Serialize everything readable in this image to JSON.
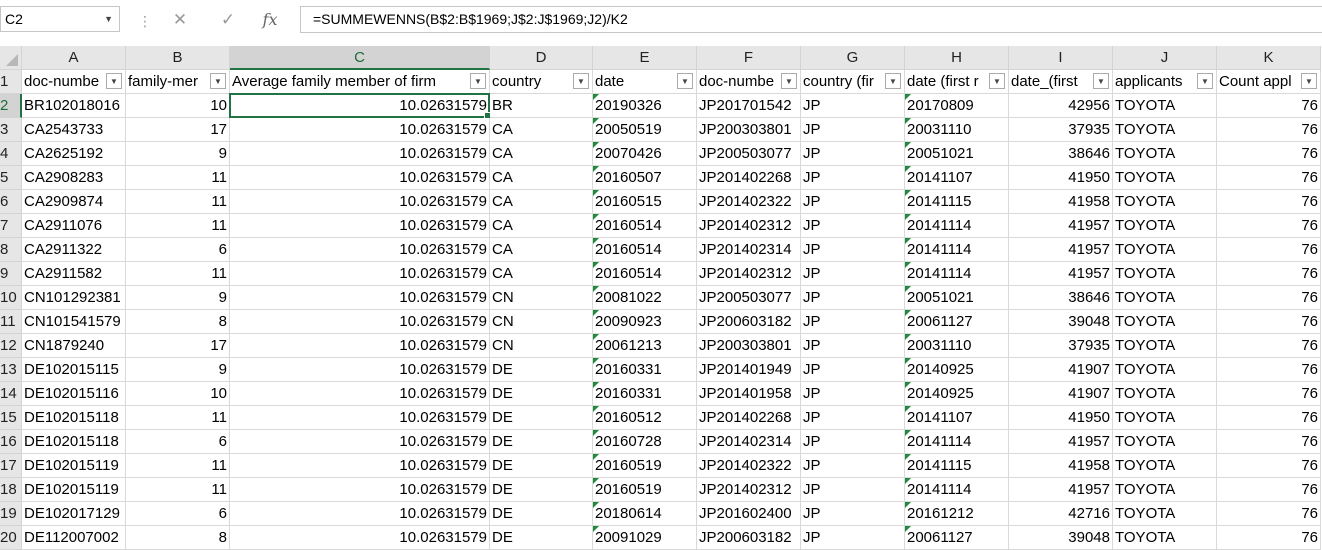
{
  "formula_bar": {
    "name_box": "C2",
    "fx_label": "fx",
    "cancel_glyph": "✕",
    "enter_glyph": "✓",
    "formula": "=SUMMEWENNS(B$2:B$1969;J$2:J$1969;J2)/K2"
  },
  "columns": [
    {
      "id": "A",
      "header": "doc-numbe",
      "width": 104,
      "align": "txt",
      "key": "a"
    },
    {
      "id": "B",
      "header": "family-mer",
      "width": 104,
      "align": "num",
      "key": "b"
    },
    {
      "id": "C",
      "header": "Average family member of firm",
      "width": 260,
      "align": "num",
      "key": "c"
    },
    {
      "id": "D",
      "header": "country",
      "width": 103,
      "align": "txt",
      "key": "d"
    },
    {
      "id": "E",
      "header": "date",
      "width": 104,
      "align": "txt",
      "key": "e",
      "err": true
    },
    {
      "id": "F",
      "header": "doc-numbe",
      "width": 104,
      "align": "txt",
      "key": "f"
    },
    {
      "id": "G",
      "header": "country (fir",
      "width": 104,
      "align": "txt",
      "key": "g"
    },
    {
      "id": "H",
      "header": "date (first r",
      "width": 104,
      "align": "txt",
      "key": "h",
      "err": true
    },
    {
      "id": "I",
      "header": "date_(first",
      "width": 104,
      "align": "num",
      "key": "i"
    },
    {
      "id": "J",
      "header": "applicants",
      "width": 104,
      "align": "txt",
      "key": "j"
    },
    {
      "id": "K",
      "header": "Count appl",
      "width": 104,
      "align": "num",
      "key": "k"
    }
  ],
  "active_cell": {
    "col": "C",
    "row": 2
  },
  "rows": [
    {
      "n": "2",
      "a": "BR102018016",
      "b": "10",
      "c": "10.02631579",
      "d": "BR",
      "e": "20190326",
      "f": "JP201701542",
      "g": "JP",
      "h": "20170809",
      "i": "42956",
      "j": "TOYOTA",
      "k": "76"
    },
    {
      "n": "3",
      "a": "CA2543733",
      "b": "17",
      "c": "10.02631579",
      "d": "CA",
      "e": "20050519",
      "f": "JP200303801",
      "g": "JP",
      "h": "20031110",
      "i": "37935",
      "j": "TOYOTA",
      "k": "76"
    },
    {
      "n": "4",
      "a": "CA2625192",
      "b": "9",
      "c": "10.02631579",
      "d": "CA",
      "e": "20070426",
      "f": "JP200503077",
      "g": "JP",
      "h": "20051021",
      "i": "38646",
      "j": "TOYOTA",
      "k": "76"
    },
    {
      "n": "5",
      "a": "CA2908283",
      "b": "11",
      "c": "10.02631579",
      "d": "CA",
      "e": "20160507",
      "f": "JP201402268",
      "g": "JP",
      "h": "20141107",
      "i": "41950",
      "j": "TOYOTA",
      "k": "76"
    },
    {
      "n": "6",
      "a": "CA2909874",
      "b": "11",
      "c": "10.02631579",
      "d": "CA",
      "e": "20160515",
      "f": "JP201402322",
      "g": "JP",
      "h": "20141115",
      "i": "41958",
      "j": "TOYOTA",
      "k": "76"
    },
    {
      "n": "7",
      "a": "CA2911076",
      "b": "11",
      "c": "10.02631579",
      "d": "CA",
      "e": "20160514",
      "f": "JP201402312",
      "g": "JP",
      "h": "20141114",
      "i": "41957",
      "j": "TOYOTA",
      "k": "76"
    },
    {
      "n": "8",
      "a": "CA2911322",
      "b": "6",
      "c": "10.02631579",
      "d": "CA",
      "e": "20160514",
      "f": "JP201402314",
      "g": "JP",
      "h": "20141114",
      "i": "41957",
      "j": "TOYOTA",
      "k": "76"
    },
    {
      "n": "9",
      "a": "CA2911582",
      "b": "11",
      "c": "10.02631579",
      "d": "CA",
      "e": "20160514",
      "f": "JP201402312",
      "g": "JP",
      "h": "20141114",
      "i": "41957",
      "j": "TOYOTA",
      "k": "76"
    },
    {
      "n": "10",
      "a": "CN101292381",
      "b": "9",
      "c": "10.02631579",
      "d": "CN",
      "e": "20081022",
      "f": "JP200503077",
      "g": "JP",
      "h": "20051021",
      "i": "38646",
      "j": "TOYOTA",
      "k": "76"
    },
    {
      "n": "11",
      "a": "CN101541579",
      "b": "8",
      "c": "10.02631579",
      "d": "CN",
      "e": "20090923",
      "f": "JP200603182",
      "g": "JP",
      "h": "20061127",
      "i": "39048",
      "j": "TOYOTA",
      "k": "76"
    },
    {
      "n": "12",
      "a": "CN1879240",
      "b": "17",
      "c": "10.02631579",
      "d": "CN",
      "e": "20061213",
      "f": "JP200303801",
      "g": "JP",
      "h": "20031110",
      "i": "37935",
      "j": "TOYOTA",
      "k": "76"
    },
    {
      "n": "13",
      "a": "DE102015115",
      "b": "9",
      "c": "10.02631579",
      "d": "DE",
      "e": "20160331",
      "f": "JP201401949",
      "g": "JP",
      "h": "20140925",
      "i": "41907",
      "j": "TOYOTA",
      "k": "76"
    },
    {
      "n": "14",
      "a": "DE102015116",
      "b": "10",
      "c": "10.02631579",
      "d": "DE",
      "e": "20160331",
      "f": "JP201401958",
      "g": "JP",
      "h": "20140925",
      "i": "41907",
      "j": "TOYOTA",
      "k": "76"
    },
    {
      "n": "15",
      "a": "DE102015118",
      "b": "11",
      "c": "10.02631579",
      "d": "DE",
      "e": "20160512",
      "f": "JP201402268",
      "g": "JP",
      "h": "20141107",
      "i": "41950",
      "j": "TOYOTA",
      "k": "76"
    },
    {
      "n": "16",
      "a": "DE102015118",
      "b": "6",
      "c": "10.02631579",
      "d": "DE",
      "e": "20160728",
      "f": "JP201402314",
      "g": "JP",
      "h": "20141114",
      "i": "41957",
      "j": "TOYOTA",
      "k": "76"
    },
    {
      "n": "17",
      "a": "DE102015119",
      "b": "11",
      "c": "10.02631579",
      "d": "DE",
      "e": "20160519",
      "f": "JP201402322",
      "g": "JP",
      "h": "20141115",
      "i": "41958",
      "j": "TOYOTA",
      "k": "76"
    },
    {
      "n": "18",
      "a": "DE102015119",
      "b": "11",
      "c": "10.02631579",
      "d": "DE",
      "e": "20160519",
      "f": "JP201402312",
      "g": "JP",
      "h": "20141114",
      "i": "41957",
      "j": "TOYOTA",
      "k": "76"
    },
    {
      "n": "19",
      "a": "DE102017129",
      "b": "6",
      "c": "10.02631579",
      "d": "DE",
      "e": "20180614",
      "f": "JP201602400",
      "g": "JP",
      "h": "20161212",
      "i": "42716",
      "j": "TOYOTA",
      "k": "76"
    },
    {
      "n": "20",
      "a": "DE112007002",
      "b": "8",
      "c": "10.02631579",
      "d": "DE",
      "e": "20091029",
      "f": "JP200603182",
      "g": "JP",
      "h": "20061127",
      "i": "39048",
      "j": "TOYOTA",
      "k": "76"
    }
  ]
}
